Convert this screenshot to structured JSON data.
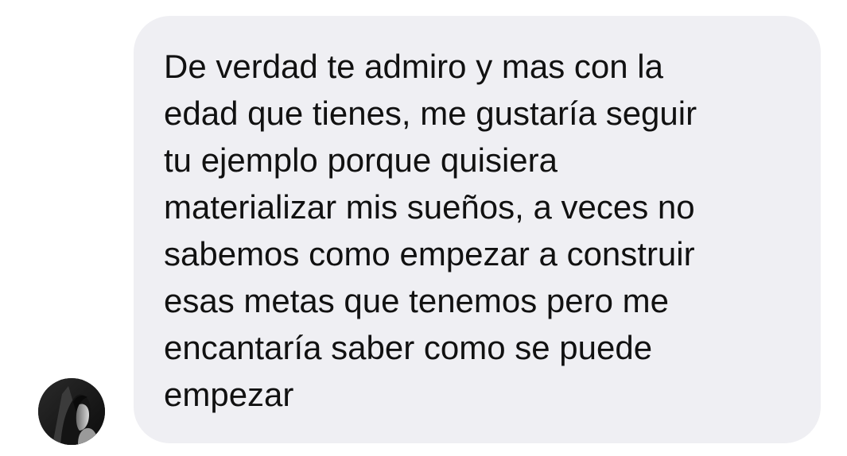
{
  "conversation": {
    "message": {
      "lines": [
        "De verdad te admiro y mas con la",
        "edad que tienes, me gustaría seguir",
        "tu ejemplo porque quisiera",
        "materializar mis sueños, a veces no",
        "sabemos como empezar a construir",
        "esas metas que tenemos pero me",
        "encantaría saber como se puede",
        "empezar"
      ],
      "bubble_color": "#efeff3",
      "text_color": "#111111"
    },
    "sender": {
      "avatar_icon": "profile-photo"
    }
  }
}
